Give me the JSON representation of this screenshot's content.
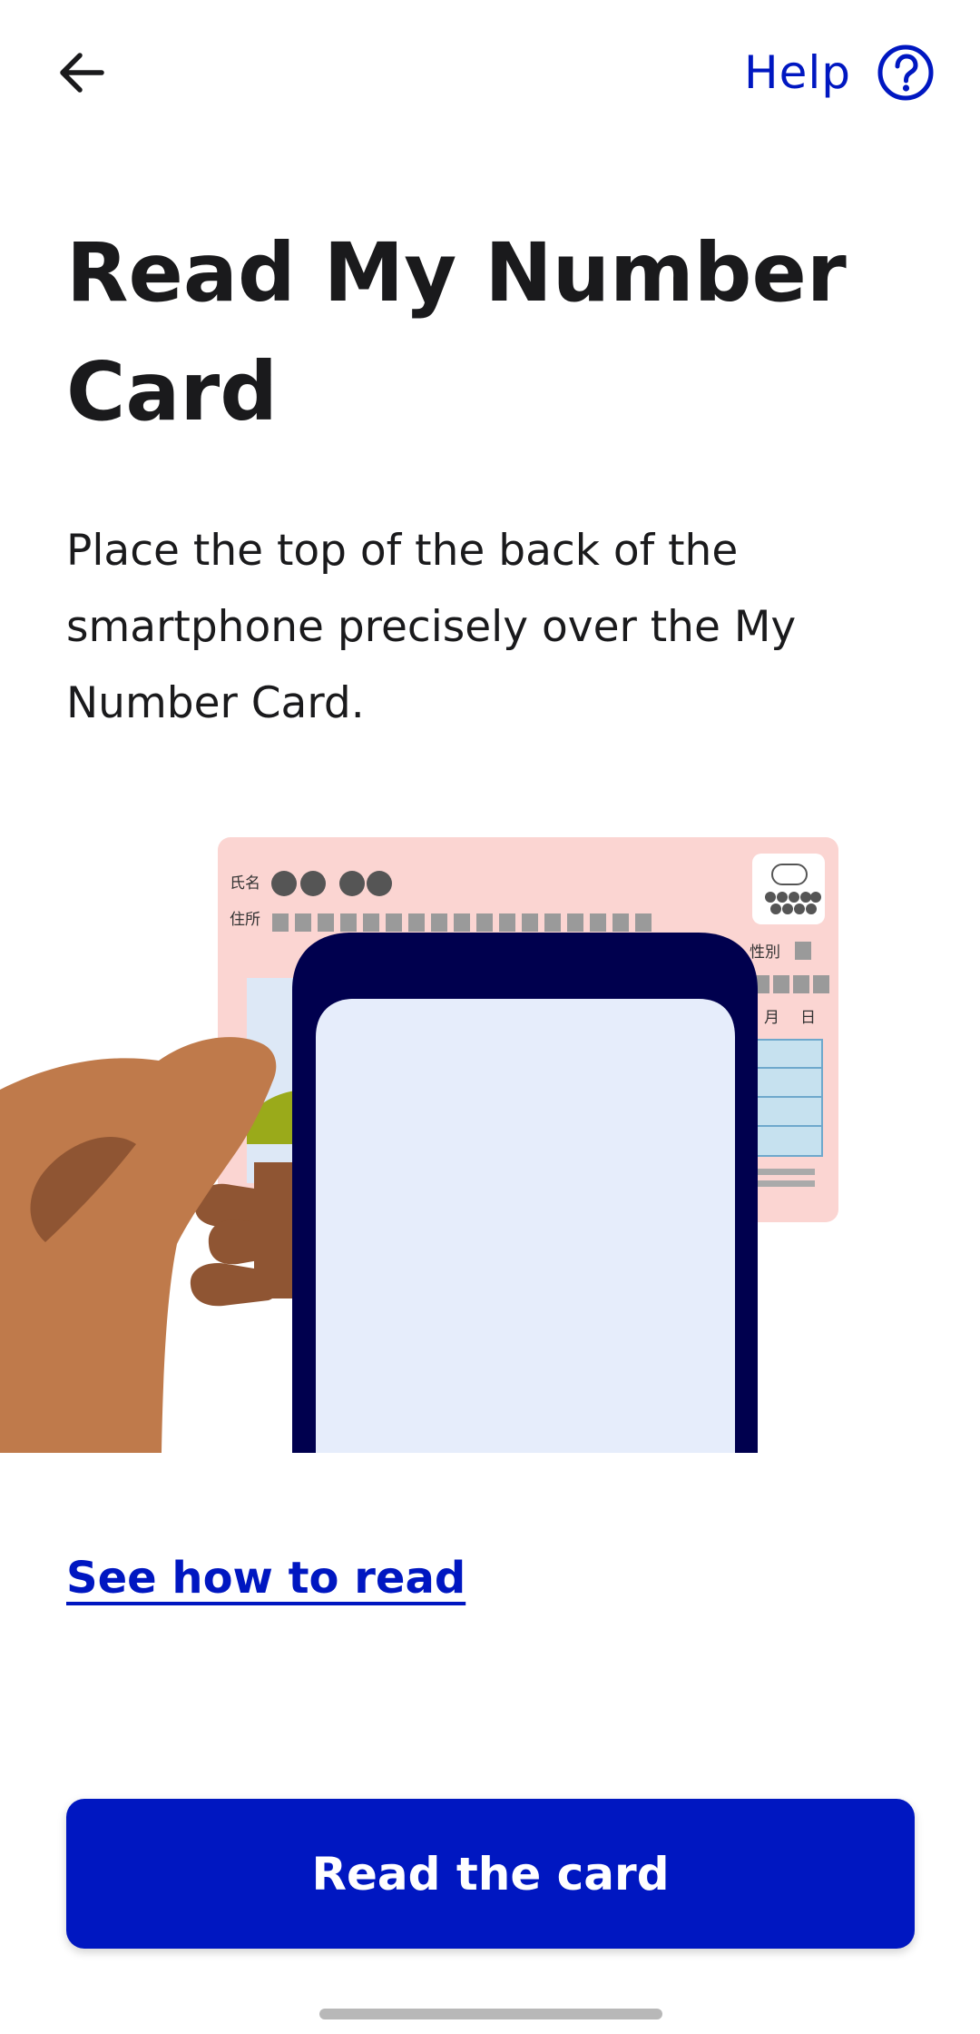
{
  "header": {
    "back_icon": "arrow-left-icon",
    "help_label": "Help",
    "help_icon": "question-circle-icon"
  },
  "title": "Read My Number Card",
  "description": "Place the top of the back of the smartphone precisely over the My Number Card.",
  "illustration": {
    "card_labels": {
      "name": "氏名",
      "address": "住所",
      "sex": "性別",
      "month": "月",
      "day": "日"
    }
  },
  "links": {
    "see_how": "See how to read"
  },
  "actions": {
    "primary_label": "Read the card"
  },
  "colors": {
    "accent": "#0017c1",
    "text": "#1a1a1c",
    "card_bg": "#fbd5d2",
    "phone_frame": "#00004e",
    "phone_screen": "#e6edfb",
    "hand_skin": "#bf7a4b",
    "hand_shadow": "#8f5533"
  }
}
